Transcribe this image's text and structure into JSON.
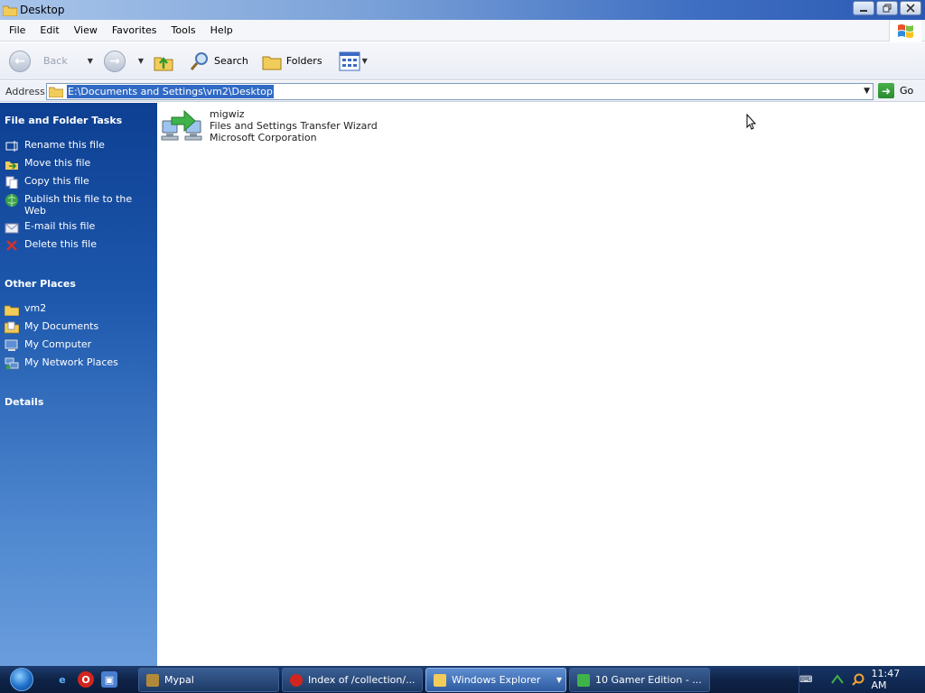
{
  "window": {
    "title": "Desktop"
  },
  "menu": [
    "File",
    "Edit",
    "View",
    "Favorites",
    "Tools",
    "Help"
  ],
  "toolbar": {
    "back": "Back",
    "search": "Search",
    "folders": "Folders"
  },
  "address": {
    "label": "Address",
    "path": "E:\\Documents and Settings\\vm2\\Desktop",
    "go": "Go"
  },
  "sidebar": {
    "file_tasks_title": "File and Folder Tasks",
    "file_tasks": [
      "Rename this file",
      "Move this file",
      "Copy this file",
      "Publish this file to the Web",
      "E-mail this file",
      "Delete this file"
    ],
    "other_places_title": "Other Places",
    "other_places": [
      "vm2",
      "My Documents",
      "My Computer",
      "My Network Places"
    ],
    "details_title": "Details"
  },
  "file": {
    "name": "migwiz",
    "description": "Files and Settings Transfer Wizard",
    "company": "Microsoft Corporation"
  },
  "taskbar": {
    "tasks": [
      "Mypal",
      "Index of /collection/...",
      "Windows Explorer",
      "10 Gamer Edition - ..."
    ],
    "active_task": "Windows Explorer",
    "clock": "11:47 AM"
  },
  "colors": {
    "sidebar_top": "#0d3f92",
    "sidebar_bottom": "#6a9ddd",
    "selection": "#316ac5"
  }
}
